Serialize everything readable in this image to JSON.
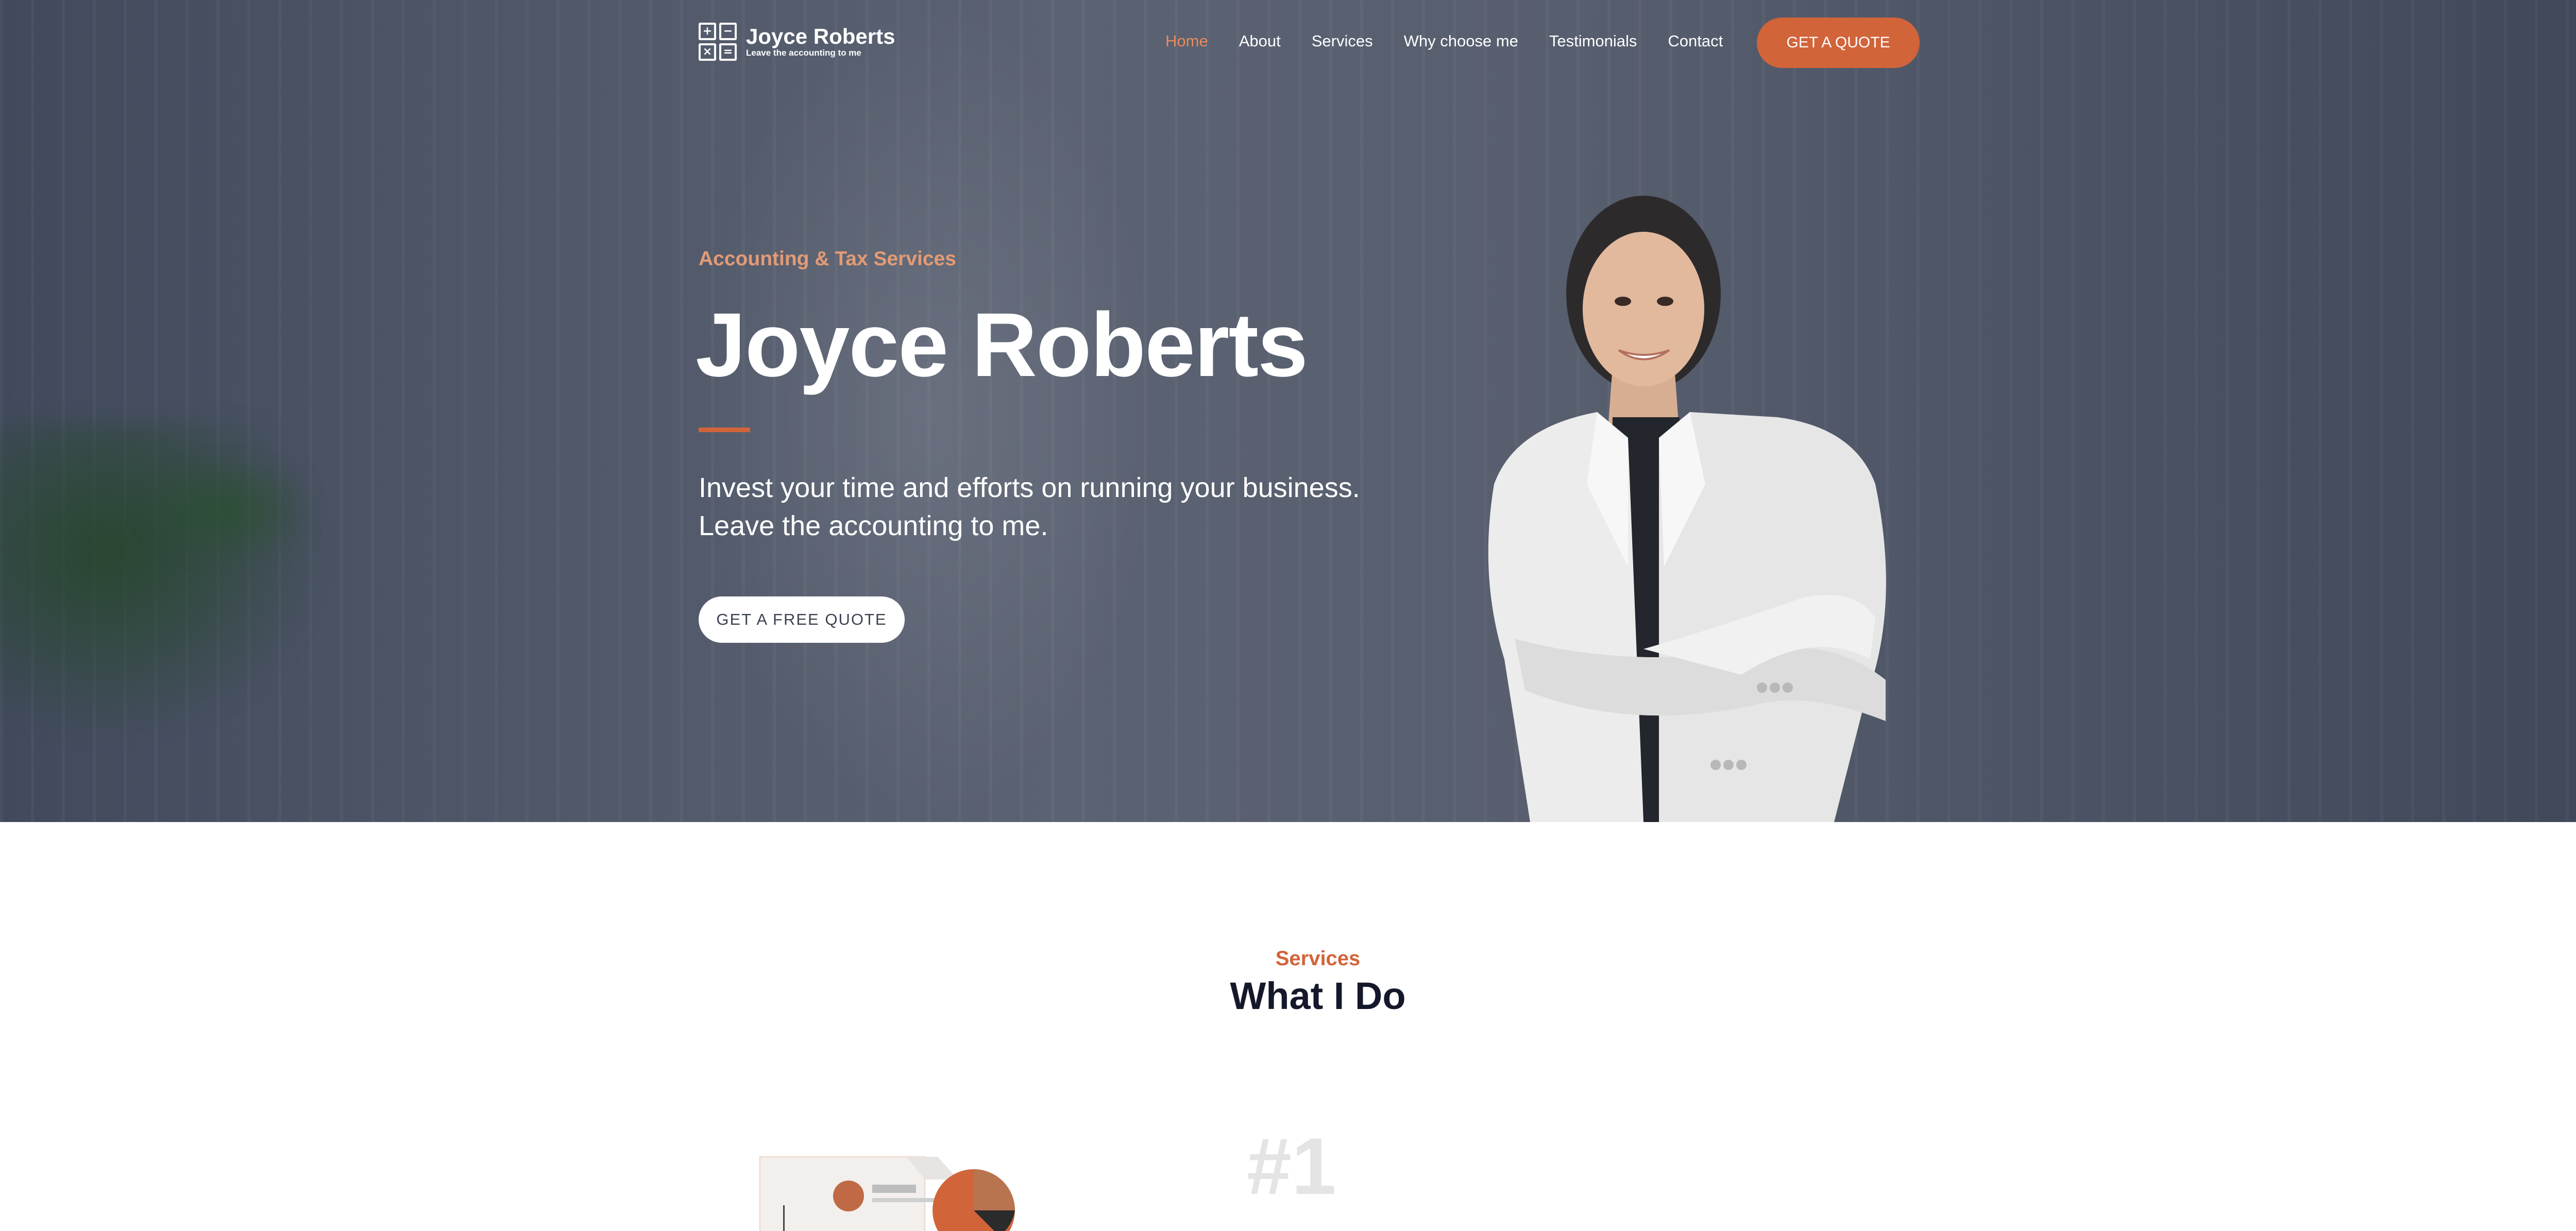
{
  "header": {
    "logo_name": "Joyce Roberts",
    "logo_tagline": "Leave the accounting to me",
    "logo_symbols": [
      "+",
      "−",
      "×",
      "="
    ],
    "nav": [
      {
        "label": "Home",
        "active": true
      },
      {
        "label": "About",
        "active": false
      },
      {
        "label": "Services",
        "active": false
      },
      {
        "label": "Why choose me",
        "active": false
      },
      {
        "label": "Testimonials",
        "active": false
      },
      {
        "label": "Contact",
        "active": false
      }
    ],
    "cta_label": "GET A QUOTE"
  },
  "hero": {
    "eyebrow": "Accounting & Tax Services",
    "title": "Joyce Roberts",
    "subtitle_line1": "Invest your time and efforts on running your business.",
    "subtitle_line2": "Leave the accounting to me.",
    "cta_label": "GET A FREE QUOTE"
  },
  "services": {
    "eyebrow": "Services",
    "title": "What I Do",
    "first_number": "#1"
  },
  "colors": {
    "accent": "#d2643a",
    "nav_active": "#e88a5c",
    "eyebrow": "#e39b75",
    "heading_dark": "#14182a",
    "hero_bg": "#525a6a"
  }
}
